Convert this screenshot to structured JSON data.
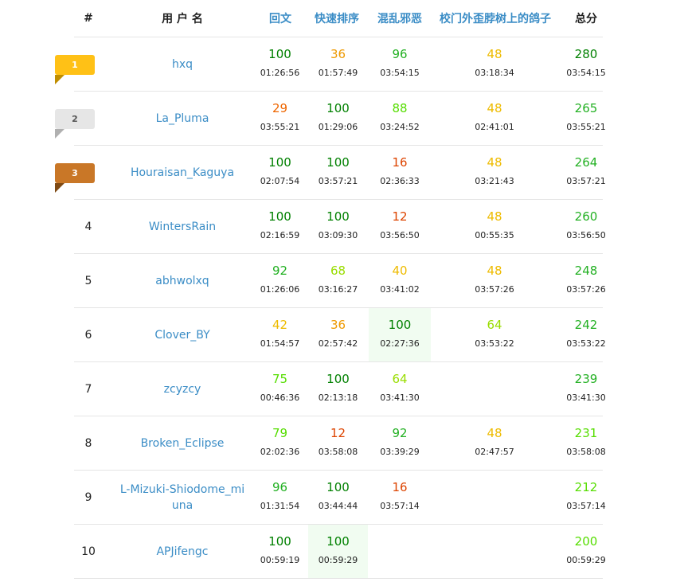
{
  "colors": {
    "score_100": "#008000",
    "score_high": "#22b022",
    "score_upper": "#55dd00",
    "score_mid": "#99dd00",
    "score_midlow": "#eebb00",
    "score_low": "#ee9900",
    "score_lower": "#ee6600",
    "score_lowest": "#dd4400",
    "link": "#3b8dc6",
    "gold": "#ffc116",
    "silver": "#e6e6e6",
    "bronze": "#c97727"
  },
  "header": {
    "rank": "#",
    "user": "用 户 名",
    "problems": [
      "回文",
      "快速排序",
      "混乱邪恶",
      "校门外歪脖树上的鸽子"
    ],
    "total": "总分"
  },
  "rows": [
    {
      "rank": "1",
      "user": "hxq",
      "medal": "gold",
      "cells": [
        {
          "score": "100",
          "time": "01:26:56",
          "color": "score_100"
        },
        {
          "score": "36",
          "time": "01:57:49",
          "color": "score_low"
        },
        {
          "score": "96",
          "time": "03:54:15",
          "color": "score_high"
        },
        {
          "score": "48",
          "time": "03:18:34",
          "color": "score_midlow"
        }
      ],
      "total": {
        "score": "280",
        "time": "03:54:15",
        "color": "score_100"
      }
    },
    {
      "rank": "2",
      "user": "La_Pluma",
      "medal": "silver",
      "cells": [
        {
          "score": "29",
          "time": "03:55:21",
          "color": "score_lower"
        },
        {
          "score": "100",
          "time": "01:29:06",
          "color": "score_100"
        },
        {
          "score": "88",
          "time": "03:24:52",
          "color": "score_upper"
        },
        {
          "score": "48",
          "time": "02:41:01",
          "color": "score_midlow"
        }
      ],
      "total": {
        "score": "265",
        "time": "03:55:21",
        "color": "score_high"
      }
    },
    {
      "rank": "3",
      "user": "Houraisan_Kaguya",
      "medal": "bronze",
      "cells": [
        {
          "score": "100",
          "time": "02:07:54",
          "color": "score_100"
        },
        {
          "score": "100",
          "time": "03:57:21",
          "color": "score_100"
        },
        {
          "score": "16",
          "time": "02:36:33",
          "color": "score_lowest"
        },
        {
          "score": "48",
          "time": "03:21:43",
          "color": "score_midlow"
        }
      ],
      "total": {
        "score": "264",
        "time": "03:57:21",
        "color": "score_high"
      }
    },
    {
      "rank": "4",
      "user": "WintersRain",
      "medal": "",
      "cells": [
        {
          "score": "100",
          "time": "02:16:59",
          "color": "score_100"
        },
        {
          "score": "100",
          "time": "03:09:30",
          "color": "score_100"
        },
        {
          "score": "12",
          "time": "03:56:50",
          "color": "score_lowest"
        },
        {
          "score": "48",
          "time": "00:55:35",
          "color": "score_midlow"
        }
      ],
      "total": {
        "score": "260",
        "time": "03:56:50",
        "color": "score_high"
      }
    },
    {
      "rank": "5",
      "user": "abhwolxq",
      "medal": "",
      "cells": [
        {
          "score": "92",
          "time": "01:26:06",
          "color": "score_high"
        },
        {
          "score": "68",
          "time": "03:16:27",
          "color": "score_mid"
        },
        {
          "score": "40",
          "time": "03:41:02",
          "color": "score_midlow"
        },
        {
          "score": "48",
          "time": "03:57:26",
          "color": "score_midlow"
        }
      ],
      "total": {
        "score": "248",
        "time": "03:57:26",
        "color": "score_high"
      }
    },
    {
      "rank": "6",
      "user": "Clover_BY",
      "medal": "",
      "cells": [
        {
          "score": "42",
          "time": "01:54:57",
          "color": "score_midlow"
        },
        {
          "score": "36",
          "time": "02:57:42",
          "color": "score_low"
        },
        {
          "score": "100",
          "time": "02:27:36",
          "color": "score_100",
          "hl": true
        },
        {
          "score": "64",
          "time": "03:53:22",
          "color": "score_mid"
        }
      ],
      "total": {
        "score": "242",
        "time": "03:53:22",
        "color": "score_high"
      }
    },
    {
      "rank": "7",
      "user": "zcyzcy",
      "medal": "",
      "cells": [
        {
          "score": "75",
          "time": "00:46:36",
          "color": "score_upper"
        },
        {
          "score": "100",
          "time": "02:13:18",
          "color": "score_100"
        },
        {
          "score": "64",
          "time": "03:41:30",
          "color": "score_mid"
        },
        {
          "score": "",
          "time": "",
          "color": "score_100"
        }
      ],
      "total": {
        "score": "239",
        "time": "03:41:30",
        "color": "score_high"
      }
    },
    {
      "rank": "8",
      "user": "Broken_Eclipse",
      "medal": "",
      "cells": [
        {
          "score": "79",
          "time": "02:02:36",
          "color": "score_upper"
        },
        {
          "score": "12",
          "time": "03:58:08",
          "color": "score_lowest"
        },
        {
          "score": "92",
          "time": "03:39:29",
          "color": "score_high"
        },
        {
          "score": "48",
          "time": "02:47:57",
          "color": "score_midlow"
        }
      ],
      "total": {
        "score": "231",
        "time": "03:58:08",
        "color": "score_upper"
      }
    },
    {
      "rank": "9",
      "user": "L-Mizuki-Shiodome_miuna",
      "medal": "",
      "cells": [
        {
          "score": "96",
          "time": "01:31:54",
          "color": "score_high"
        },
        {
          "score": "100",
          "time": "03:44:44",
          "color": "score_100"
        },
        {
          "score": "16",
          "time": "03:57:14",
          "color": "score_lowest"
        },
        {
          "score": "",
          "time": "",
          "color": "score_100"
        }
      ],
      "total": {
        "score": "212",
        "time": "03:57:14",
        "color": "score_upper"
      }
    },
    {
      "rank": "10",
      "user": "APJifengc",
      "medal": "",
      "cells": [
        {
          "score": "100",
          "time": "00:59:19",
          "color": "score_100"
        },
        {
          "score": "100",
          "time": "00:59:29",
          "color": "score_100",
          "hl": true
        },
        {
          "score": "",
          "time": "",
          "color": "score_100"
        },
        {
          "score": "",
          "time": "",
          "color": "score_100"
        }
      ],
      "total": {
        "score": "200",
        "time": "00:59:29",
        "color": "score_upper"
      }
    }
  ]
}
